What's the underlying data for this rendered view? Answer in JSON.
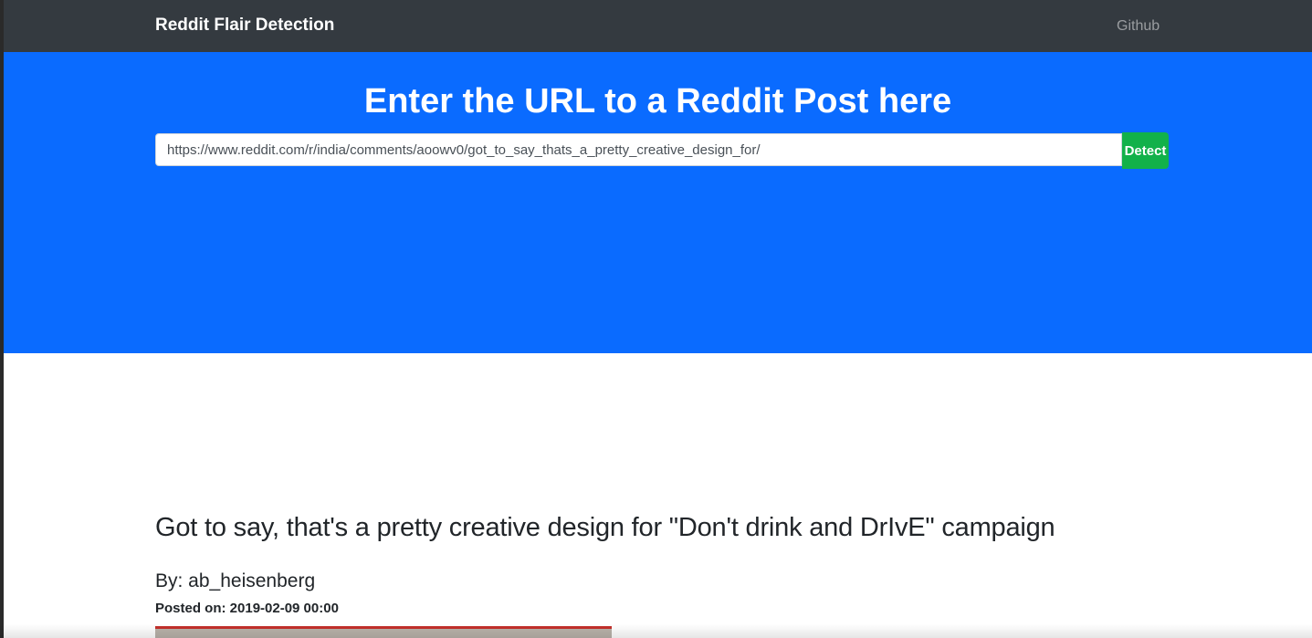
{
  "navbar": {
    "brand": "Reddit Flair Detection",
    "github_link": "Github"
  },
  "hero": {
    "title": "Enter the URL to a Reddit Post here",
    "url_input_value": "https://www.reddit.com/r/india/comments/aoowv0/got_to_say_thats_a_pretty_creative_design_for/",
    "detect_button": "Detect"
  },
  "post": {
    "title": "Got to say, that's a pretty creative design for \"Don't drink and DrIvE\" campaign",
    "author": "By: ab_heisenberg",
    "posted_on": "Posted on: 2019-02-09 00:00"
  },
  "colors": {
    "navbar": "#343a40",
    "hero": "#0a6bff",
    "detect_button": "#12b14a",
    "text": "#212529"
  }
}
